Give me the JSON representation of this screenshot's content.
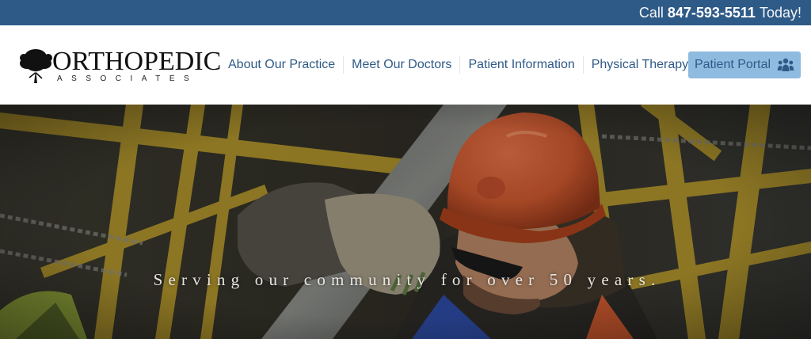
{
  "topbar": {
    "prefix": "Call",
    "phone": "847-593-5511",
    "suffix": "Today!"
  },
  "logo": {
    "main": "ORTHOPEDIC",
    "sub": "ASSOCIATES",
    "icon": "tree-icon"
  },
  "nav": {
    "items": [
      {
        "label": "About Our Practice"
      },
      {
        "label": "Meet Our Doctors"
      },
      {
        "label": "Patient Information"
      },
      {
        "label": "Physical Therapy"
      }
    ],
    "portal": {
      "label": "Patient Portal",
      "icon": "people-icon"
    }
  },
  "hero": {
    "tagline": "Serving our community for over 50 years."
  },
  "colors": {
    "brand": "#2e5a87",
    "portal_bg": "#8fbbe0",
    "hardhat": "#c9572e",
    "scaffold": "#b89a2c"
  }
}
